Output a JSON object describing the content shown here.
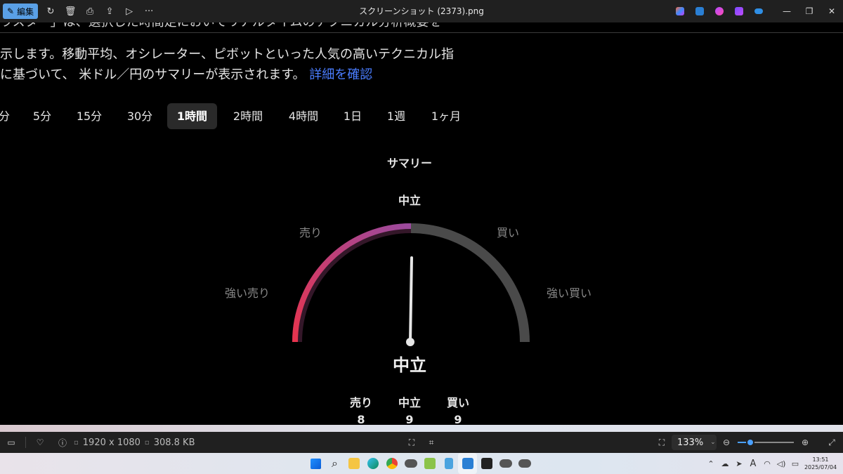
{
  "titlebar": {
    "edit_label": "編集",
    "title": "スクリーンショット (2373).png",
    "more": "···",
    "min": "—",
    "restore": "❐",
    "close": "✕"
  },
  "content": {
    "para_line1": "ラスター」は、選択した時間足においてリアルタイムのテクニカル分析概要を",
    "para_line2": "示します。移動平均、オシレーター、ピボットといった人気の高いテクニカル指",
    "para_line3_prefix": "に基づいて、 米ドル／円のサマリーが表示されます。",
    "para_link": "詳細を確認",
    "tabs": [
      {
        "label": "分",
        "active": false
      },
      {
        "label": "5分",
        "active": false
      },
      {
        "label": "15分",
        "active": false
      },
      {
        "label": "30分",
        "active": false
      },
      {
        "label": "1時間",
        "active": true
      },
      {
        "label": "2時間",
        "active": false
      },
      {
        "label": "4時間",
        "active": false
      },
      {
        "label": "1日",
        "active": false
      },
      {
        "label": "1週",
        "active": false
      },
      {
        "label": "1ヶ月",
        "active": false
      }
    ],
    "summary_title": "サマリー",
    "summary_value_top": "中立",
    "gauge_labels": {
      "strong_sell": "強い売り",
      "sell": "売り",
      "buy": "買い",
      "strong_buy": "強い買い"
    },
    "gauge_needle_value": 0.5,
    "summary_result": "中立",
    "counts": [
      {
        "label": "売り",
        "value": "8"
      },
      {
        "label": "中立",
        "value": "9"
      },
      {
        "label": "買い",
        "value": "9"
      }
    ]
  },
  "statusbar": {
    "dimensions": "1920 x 1080",
    "filesize": "308.8 KB",
    "zoom": "133%",
    "zoom_level": 0.22
  },
  "taskbar": {
    "time": "13:51",
    "date": "2025/07/04"
  },
  "colors": {
    "accent": "#5aa0e6",
    "link": "#4a7dff",
    "gauge_red": "#e8344e",
    "gauge_purple": "#9b4a9e",
    "gauge_gray": "#4a4a4a"
  }
}
